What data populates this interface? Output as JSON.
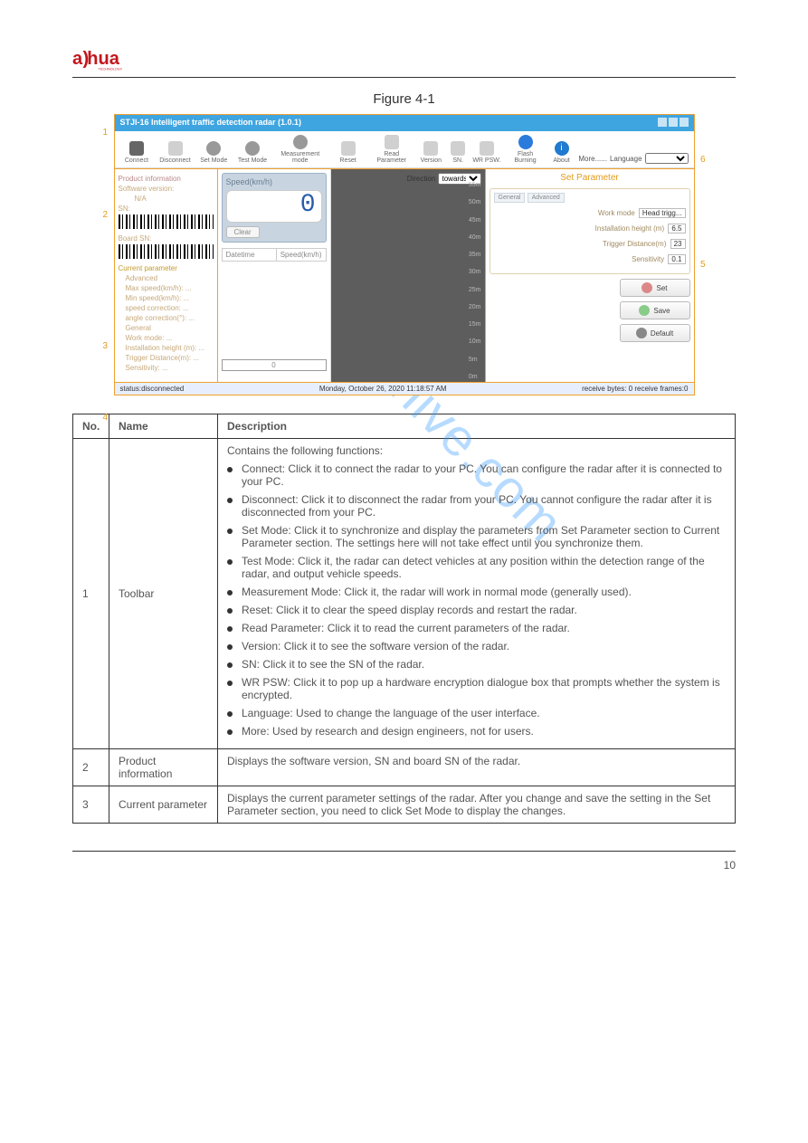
{
  "logo_sub": "TECHNOLOGY",
  "figure_caption": "Figure 4-1",
  "page_number": "10",
  "watermark": "manualshive.com",
  "screenshot": {
    "window_title": "STJI-16 Intelligent traffic detection radar (1.0.1)",
    "toolbar": {
      "connect": "Connect",
      "disconnect": "Disconnect",
      "set_mode": "Set Mode",
      "test_mode": "Test Mode",
      "measure_mode": "Measurement mode",
      "reset": "Reset",
      "read_parameter": "Read Parameter",
      "version": "Version",
      "sn": "SN.",
      "wr_psw": "WR PSW.",
      "flash_burning": "Flash Burning",
      "about": "About",
      "more": "More......",
      "language_label": "Language"
    },
    "left_panel": {
      "product_info": "Product information",
      "software_version": "Software version:",
      "na": "N/A",
      "sn_label": "SN:",
      "board_sn_label": "Board SN:",
      "current_parameter": "Current parameter",
      "advanced": "Advanced",
      "max_speed": "Max speed(km/h): ...",
      "min_speed": "Min speed(km/h): ...",
      "speed_correction": "speed correction: ...",
      "angle_correction": "angle correction(°): ...",
      "general": "General",
      "work_mode": "Work mode: ...",
      "installation_height": "Installation height (m): ...",
      "trigger_distance": "Trigger Distance(m): ...",
      "sensitivity": "Sensitivity: ..."
    },
    "speed_panel": {
      "title": "Speed(km/h)",
      "value": "0",
      "clear": "Clear",
      "col_datetime": "Datetime",
      "col_speed": "Speed(km/h)",
      "bottom_count": "0"
    },
    "plot": {
      "direction_label": "Direction",
      "direction_value": "towards",
      "ticks": [
        "55m",
        "50m",
        "45m",
        "40m",
        "35m",
        "30m",
        "25m",
        "20m",
        "15m",
        "10m",
        "5m",
        "0m"
      ]
    },
    "right_panel": {
      "title": "Set Parameter",
      "tab_general": "General",
      "tab_advanced": "Advanced",
      "work_mode_label": "Work mode",
      "work_mode_value": "Head trigg...",
      "install_h_label": "Installation height (m)",
      "install_h_value": "6.5",
      "trig_dist_label": "Trigger Distance(m)",
      "trig_dist_value": "23",
      "sens_label": "Sensitivity",
      "sens_value": "0.1",
      "set": "Set",
      "save": "Save",
      "default": "Default"
    },
    "status": {
      "conn": "status:disconnected",
      "datetime": "Monday, October 26, 2020   11:18:57 AM",
      "recv": "receive bytes: 0    receive frames:0"
    },
    "callouts": {
      "c1": "1",
      "c2": "2",
      "c3": "3",
      "c4": "4",
      "c5": "5",
      "c6": "6"
    }
  },
  "table": {
    "header_no": "No.",
    "header_name": "Name",
    "header_desc": "Description",
    "rows": [
      {
        "no": "1",
        "name": "Toolbar",
        "intro": "Contains the following functions:",
        "bullets": [
          "Connect: Click it to connect the radar to your PC. You can configure the radar after it is connected to your PC.",
          "Disconnect: Click it to disconnect the radar from your PC. You cannot configure the radar after it is disconnected from your PC.",
          "Set Mode: Click it to synchronize and display the parameters from Set Parameter section to Current Parameter section. The settings here will not take effect until you synchronize them.",
          "Test Mode: Click it, the radar can detect vehicles at any position within the detection range of the radar, and output vehicle speeds.",
          "Measurement Mode: Click it, the radar will work in normal mode (generally used).",
          "Reset: Click it to clear the speed display records and restart the radar.",
          "Read Parameter: Click it to read the current parameters of the radar.",
          "Version: Click it to see the software version of the radar.",
          "SN: Click it to see the SN of the radar.",
          "WR PSW: Click it to pop up a hardware encryption dialogue box that prompts whether the system is encrypted.",
          "Language: Used to change the language of the user interface.",
          "More: Used by research and design engineers, not for users."
        ]
      },
      {
        "no": "2",
        "name": "Product information",
        "desc": "Displays the software version, SN and board SN of the radar."
      },
      {
        "no": "3",
        "name": "Current parameter",
        "desc": "Displays the current parameter settings of the radar. After you change and save the setting in the Set Parameter section, you need to click Set Mode to display the changes."
      }
    ]
  }
}
